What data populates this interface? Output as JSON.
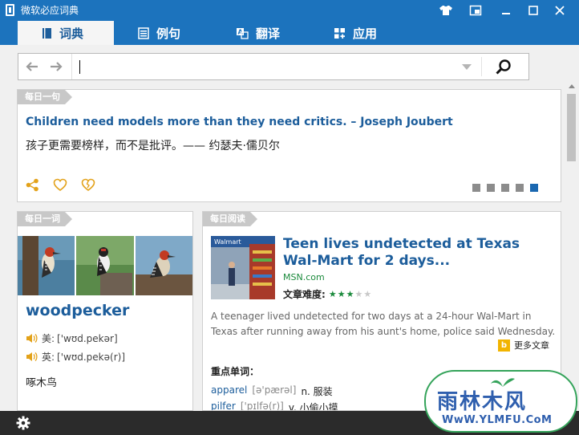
{
  "window": {
    "title": "微软必应词典"
  },
  "tabs": [
    {
      "label": "词典",
      "icon": "book-icon",
      "active": true
    },
    {
      "label": "例句",
      "icon": "list-icon",
      "active": false
    },
    {
      "label": "翻译",
      "icon": "translate-icon",
      "active": false
    },
    {
      "label": "应用",
      "icon": "apps-icon",
      "active": false
    }
  ],
  "search": {
    "value": "",
    "placeholder": ""
  },
  "daily_sentence": {
    "badge": "每日一句",
    "english": "Children need models more than they need critics. – Joseph Joubert",
    "chinese": "孩子更需要榜样，而不是批评。—— 约瑟夫·儒贝尔",
    "page_count": 5,
    "active_page": 5
  },
  "daily_word": {
    "badge": "每日一词",
    "word": "woodpecker",
    "us_label": "美:",
    "us_pron": "['wʊd.pekər]",
    "uk_label": "英:",
    "uk_pron": "['wʊd.pekə(r)]",
    "meaning": "啄木鸟"
  },
  "daily_reading": {
    "badge": "每日阅读",
    "title": "Teen lives undetected at Texas Wal-Mart for 2 days...",
    "source": "MSN.com",
    "difficulty_label": "文章难度:",
    "difficulty_stars": 3,
    "difficulty_max": 5,
    "summary": "A teenager lived undetected for two days at a 24-hour Wal-Mart in Texas after running away from his aunt's home, police said Wednesday.",
    "more_label": "更多文章",
    "key_words_label": "重点单词：",
    "key_words": [
      {
        "word": "apparel",
        "phonetic": "[ə'pærəl]",
        "definition": "n. 服装"
      },
      {
        "word": "pilfer",
        "phonetic": "['pɪlfə(r)]",
        "definition": "v. 小偷小摸"
      }
    ]
  },
  "watermark": {
    "text_cn": "雨林木风",
    "text_url": "WwW.YLMFU.CoM"
  },
  "colors": {
    "accent": "#1c73bd",
    "link": "#1c5d9b",
    "source": "#1b8a3c",
    "star_on": "#1b8a3c",
    "star_off": "#c8c8c8",
    "icon_gold": "#e3a21a"
  }
}
